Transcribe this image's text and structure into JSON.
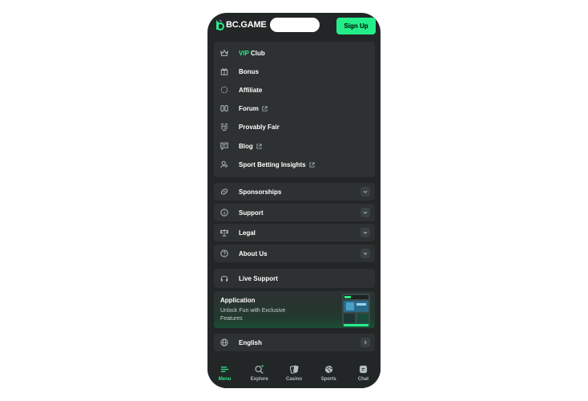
{
  "header": {
    "logo_text": "BC.GAME",
    "signup_label": "Sign Up"
  },
  "menu": {
    "vip_prefix": "VIP",
    "vip_suffix": " Club",
    "items": [
      {
        "label": "Bonus",
        "icon": "gift-icon"
      },
      {
        "label": "Affiliate",
        "icon": "affiliate-icon"
      },
      {
        "label": "Forum",
        "icon": "forum-icon",
        "external": true
      },
      {
        "label": "Provably Fair",
        "icon": "provably-fair-icon"
      },
      {
        "label": "Blog",
        "icon": "blog-icon",
        "external": true
      },
      {
        "label": "Sport Betting Insights",
        "icon": "insights-icon",
        "external": true
      }
    ]
  },
  "accordions": [
    {
      "label": "Sponsorships",
      "icon": "sponsorship-icon"
    },
    {
      "label": "Support",
      "icon": "info-icon"
    },
    {
      "label": "Legal",
      "icon": "scales-icon"
    },
    {
      "label": "About Us",
      "icon": "question-icon"
    }
  ],
  "live_support": {
    "label": "Live Support",
    "icon": "headset-icon"
  },
  "application": {
    "title": "Application",
    "subtitle": "Unlock Fun with Exclusive Features"
  },
  "language": {
    "label": "English",
    "icon": "globe-icon"
  },
  "bottom_nav": [
    {
      "label": "Menu",
      "icon": "menu-icon",
      "active": true
    },
    {
      "label": "Explore",
      "icon": "explore-icon"
    },
    {
      "label": "Casino",
      "icon": "casino-icon"
    },
    {
      "label": "Sports",
      "icon": "sports-icon"
    },
    {
      "label": "Chat",
      "icon": "chat-icon"
    }
  ],
  "colors": {
    "accent": "#24ee89",
    "background": "#232626",
    "panel": "#2d3131",
    "muted": "#b3bec1"
  }
}
